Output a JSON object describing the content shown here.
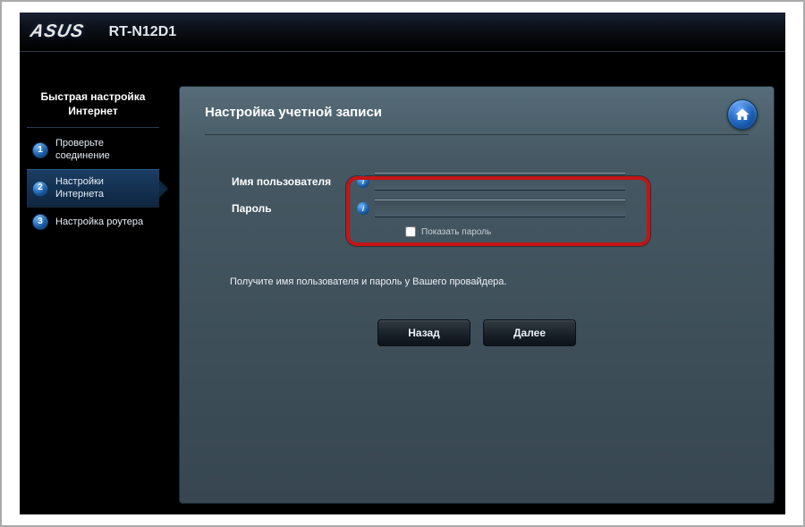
{
  "header": {
    "brand": "ASUS",
    "model": "RT-N12D1"
  },
  "sidebar": {
    "title": "Быстрая настройка Интернет",
    "steps": [
      {
        "num": "1",
        "label": "Проверьте соединение",
        "active": false
      },
      {
        "num": "2",
        "label": "Настройки Интернета",
        "active": true
      },
      {
        "num": "3",
        "label": "Настройка роутера",
        "active": false
      }
    ]
  },
  "panel": {
    "title": "Настройка учетной записи",
    "form": {
      "username_label": "Имя пользователя",
      "username_value": "",
      "password_label": "Пароль",
      "password_value": "",
      "show_password_label": "Показать пароль"
    },
    "help_text": "Получите имя пользователя и пароль у Вашего провайдера.",
    "buttons": {
      "back": "Назад",
      "next": "Далее"
    }
  },
  "icons": {
    "help_char": "i"
  }
}
